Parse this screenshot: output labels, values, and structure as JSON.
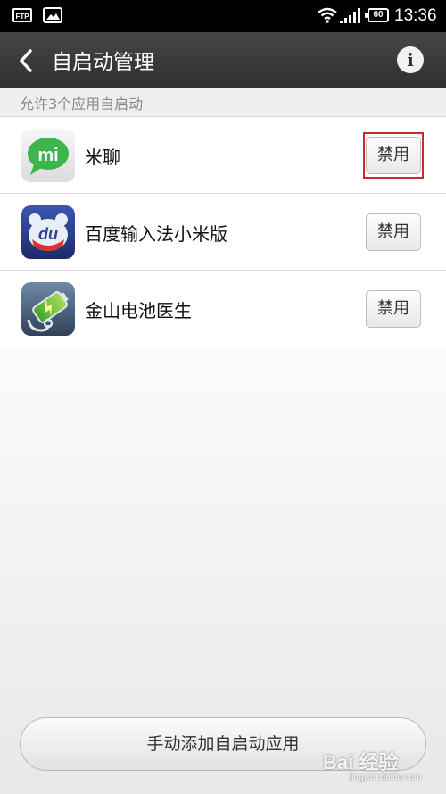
{
  "status_bar": {
    "ftp_label": "FTP",
    "battery": "60",
    "time": "13:36",
    "icons": [
      "ftp-icon",
      "picture-icon",
      "wifi-icon",
      "signal-icon",
      "battery-icon"
    ]
  },
  "header": {
    "title": "自启动管理",
    "back_icon": "back-icon",
    "info_icon": "info-icon",
    "info_glyph": "i",
    "bar_color": "#3a3a3a"
  },
  "section": {
    "label": "允许3个应用自启动"
  },
  "apps": [
    {
      "name": "米聊",
      "button": "禁用",
      "icon": "miliao-icon",
      "icon_text": "mi",
      "highlighted": true
    },
    {
      "name": "百度输入法小米版",
      "button": "禁用",
      "icon": "baidu-input-icon",
      "icon_text": "du"
    },
    {
      "name": "金山电池医生",
      "button": "禁用",
      "icon": "battery-doctor-icon"
    }
  ],
  "bottom": {
    "add_button": "手动添加自启动应用"
  },
  "watermark": {
    "main": "Bai 经验",
    "sub": "jingyan.baidu.com"
  },
  "colors": {
    "highlight": "#c92b2b",
    "miliao_green": "#3cb54a",
    "baidu_blue": "#2a3f8f"
  }
}
